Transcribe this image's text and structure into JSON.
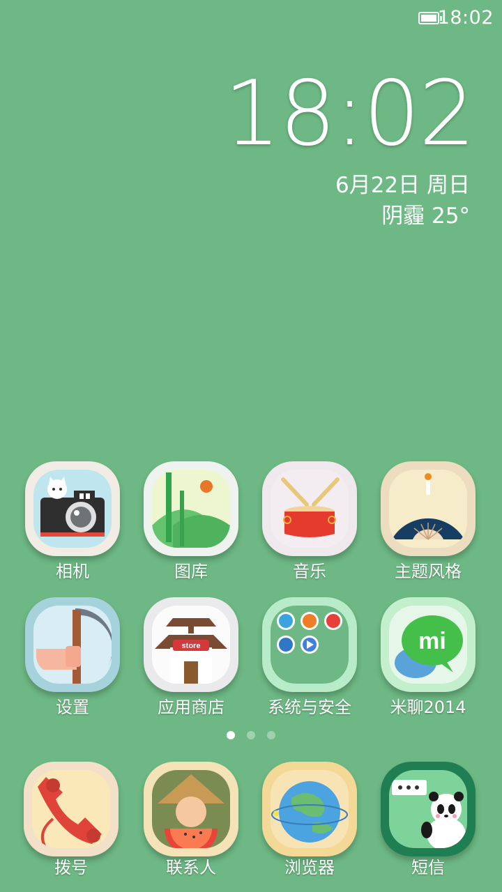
{
  "status_bar": {
    "time": "18:02",
    "battery_icon": "battery-icon"
  },
  "lockclock": {
    "time": "18:02",
    "date": "6月22日 周日",
    "weather": "阴霾  25°"
  },
  "home_apps": [
    {
      "label": "相机",
      "icon": "camera-icon"
    },
    {
      "label": "图库",
      "icon": "gallery-icon"
    },
    {
      "label": "音乐",
      "icon": "drum-icon"
    },
    {
      "label": "主题风格",
      "icon": "fan-icon"
    },
    {
      "label": "设置",
      "icon": "sickle-icon"
    },
    {
      "label": "应用商店",
      "icon": "store-icon"
    },
    {
      "label": "系统与安全",
      "icon": "folder-icon"
    },
    {
      "label": "米聊2014",
      "icon": "mi-chat-icon"
    }
  ],
  "page_indicator": {
    "pages": 3,
    "active": 1
  },
  "dock_apps": [
    {
      "label": "拨号",
      "icon": "phone-icon"
    },
    {
      "label": "联系人",
      "icon": "contacts-icon"
    },
    {
      "label": "浏览器",
      "icon": "globe-icon"
    },
    {
      "label": "短信",
      "icon": "panda-message-icon"
    }
  ],
  "colors": {
    "wallpaper": "#6db884",
    "text": "#ffffff"
  }
}
